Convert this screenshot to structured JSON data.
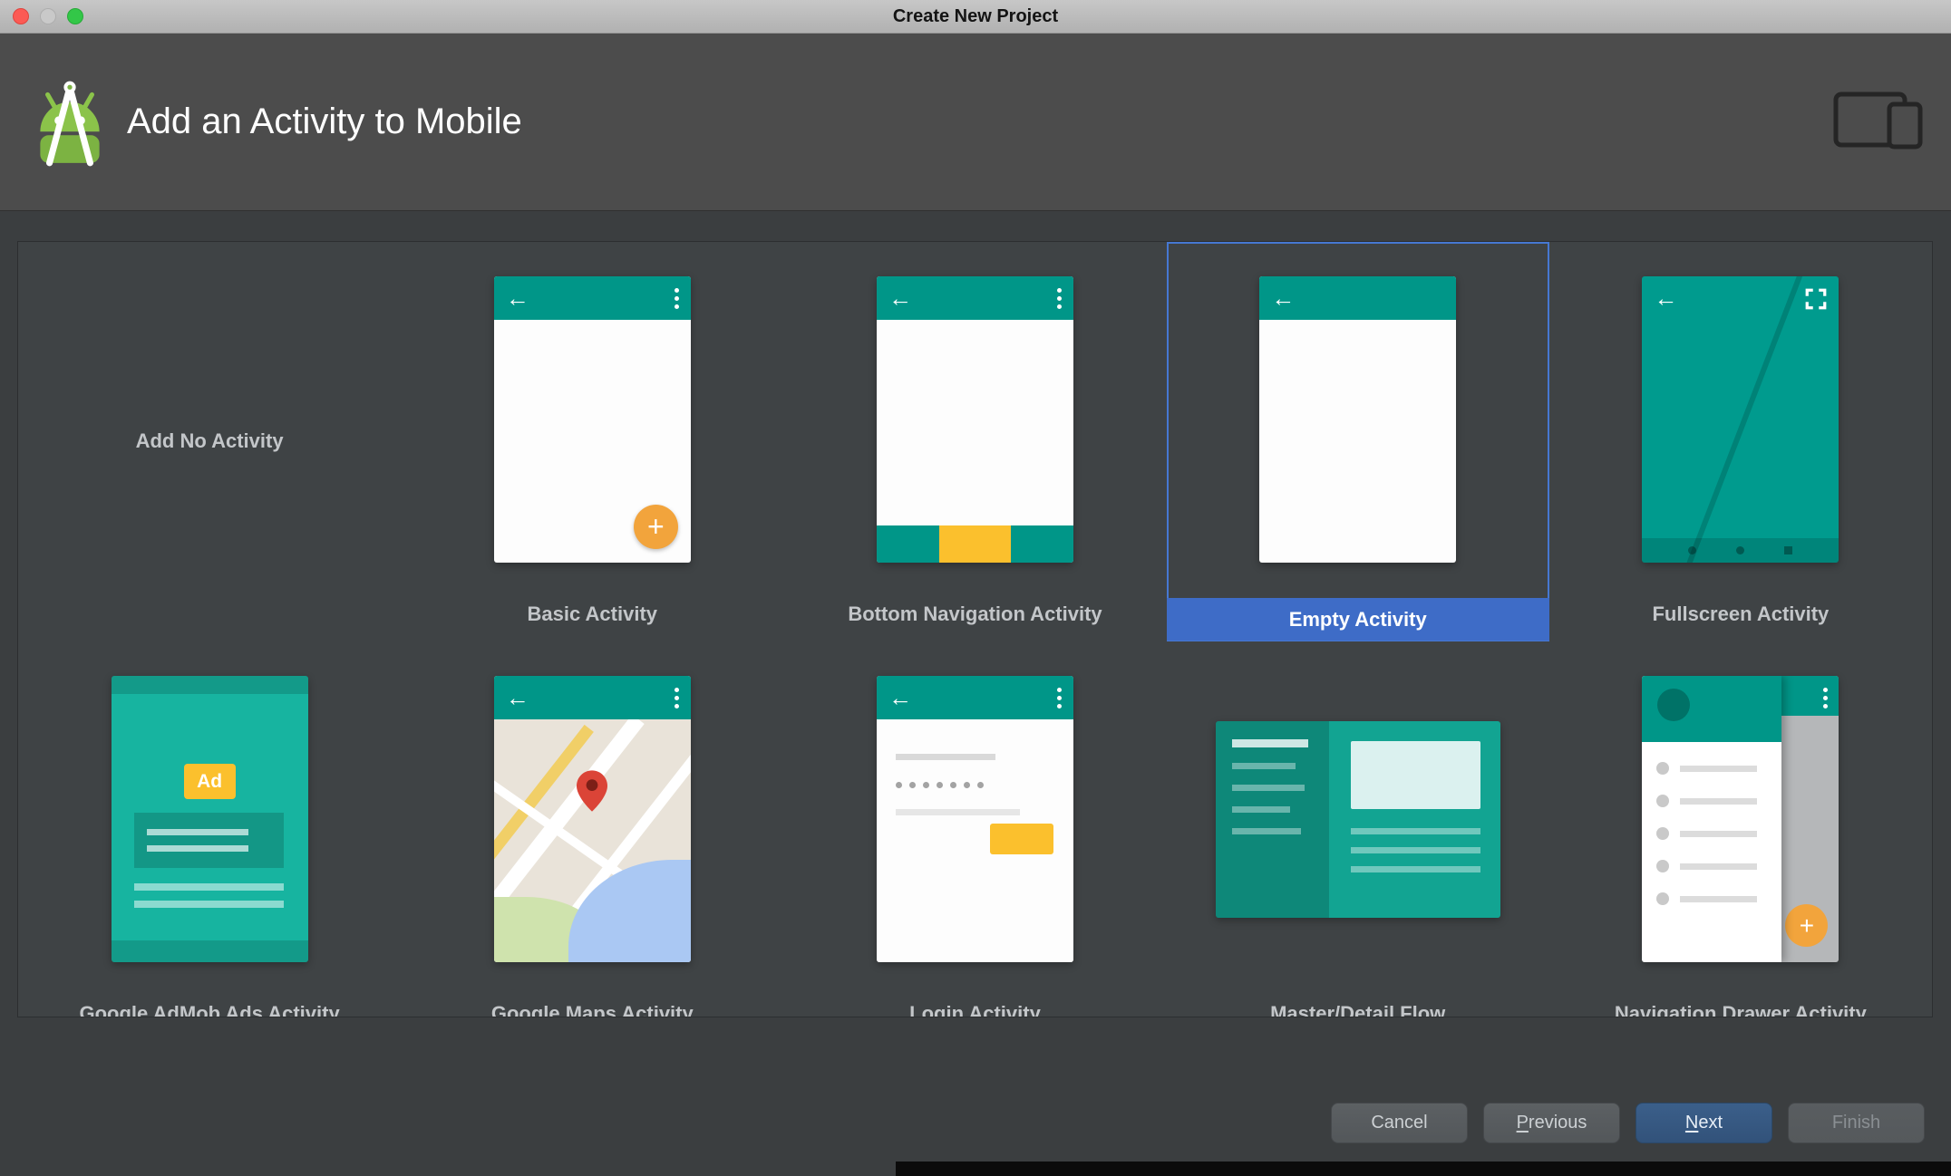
{
  "window": {
    "title": "Create New Project"
  },
  "header": {
    "title": "Add an Activity to Mobile"
  },
  "gallery": {
    "selected_index": 3,
    "fab_plus": "+",
    "ad_badge_text": "Ad",
    "items": [
      {
        "label": "Add No Activity",
        "selected": false
      },
      {
        "label": "Basic Activity",
        "selected": false
      },
      {
        "label": "Bottom Navigation Activity",
        "selected": false
      },
      {
        "label": "Empty Activity",
        "selected": true
      },
      {
        "label": "Fullscreen Activity",
        "selected": false
      },
      {
        "label": "Google AdMob Ads Activity",
        "selected": false
      },
      {
        "label": "Google Maps Activity",
        "selected": false
      },
      {
        "label": "Login Activity",
        "selected": false
      },
      {
        "label": "Master/Detail Flow",
        "selected": false
      },
      {
        "label": "Navigation Drawer Activity",
        "selected": false
      }
    ]
  },
  "footer": {
    "buttons": [
      {
        "label": "Cancel",
        "enabled": true
      },
      {
        "label": "Previous",
        "mnemonic": "P",
        "enabled": true
      },
      {
        "label": "Next",
        "mnemonic": "N",
        "enabled": true,
        "default": true
      },
      {
        "label": "Finish",
        "enabled": false
      }
    ]
  },
  "colors": {
    "teal": "#009688",
    "amber": "#fbc02d",
    "fab_orange": "#f2a43c",
    "selection_blue": "#3e6cc7",
    "primary_button_blue": "#365880",
    "header_bg": "#4c4c4c",
    "dialog_bg": "#3b3e40"
  }
}
